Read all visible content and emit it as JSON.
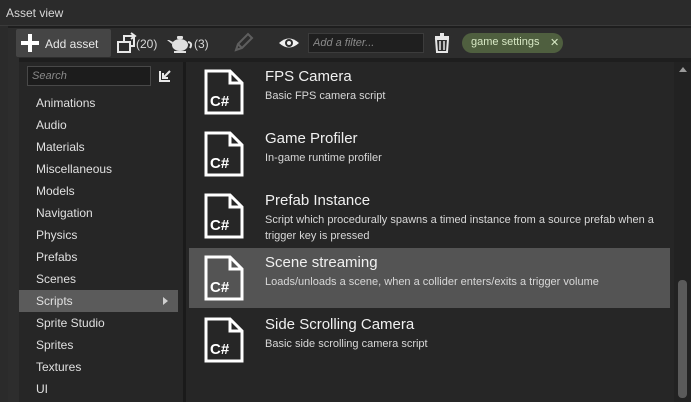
{
  "window": {
    "title": "Asset view"
  },
  "toolbar": {
    "add_asset_label": "Add asset",
    "recent_count": "(20)",
    "teapot_count": "(3)",
    "filter_placeholder": "Add a filter...",
    "tag_label": "game settings",
    "tag_close": "✕"
  },
  "sidebar": {
    "search_placeholder": "Search",
    "items": [
      {
        "label": "Animations"
      },
      {
        "label": "Audio"
      },
      {
        "label": "Materials"
      },
      {
        "label": "Miscellaneous"
      },
      {
        "label": "Models"
      },
      {
        "label": "Navigation"
      },
      {
        "label": "Physics"
      },
      {
        "label": "Prefabs"
      },
      {
        "label": "Scenes"
      },
      {
        "label": "Scripts",
        "selected": true
      },
      {
        "label": "Sprite Studio"
      },
      {
        "label": "Sprites"
      },
      {
        "label": "Textures"
      },
      {
        "label": "UI"
      }
    ]
  },
  "assets": [
    {
      "icon": "csharp-file-icon",
      "icon_text": "C#",
      "name": "FPS Camera",
      "description": "Basic FPS camera script"
    },
    {
      "icon": "csharp-file-icon",
      "icon_text": "C#",
      "name": "Game Profiler",
      "description": "In-game runtime profiler"
    },
    {
      "icon": "csharp-file-icon",
      "icon_text": "C#",
      "name": "Prefab Instance",
      "description": "Script which procedurally spawns a timed instance from a source prefab when a trigger key is pressed"
    },
    {
      "icon": "csharp-file-icon",
      "icon_text": "C#",
      "name": "Scene streaming",
      "description": "Loads/unloads a scene, when a collider enters/exits a trigger volume",
      "selected": true
    },
    {
      "icon": "csharp-file-icon",
      "icon_text": "C#",
      "name": "Side Scrolling Camera",
      "description": "Basic side scrolling camera script"
    }
  ],
  "colors": {
    "background": "#262626",
    "selection": "#545454",
    "tag": "#4f5f3f"
  }
}
